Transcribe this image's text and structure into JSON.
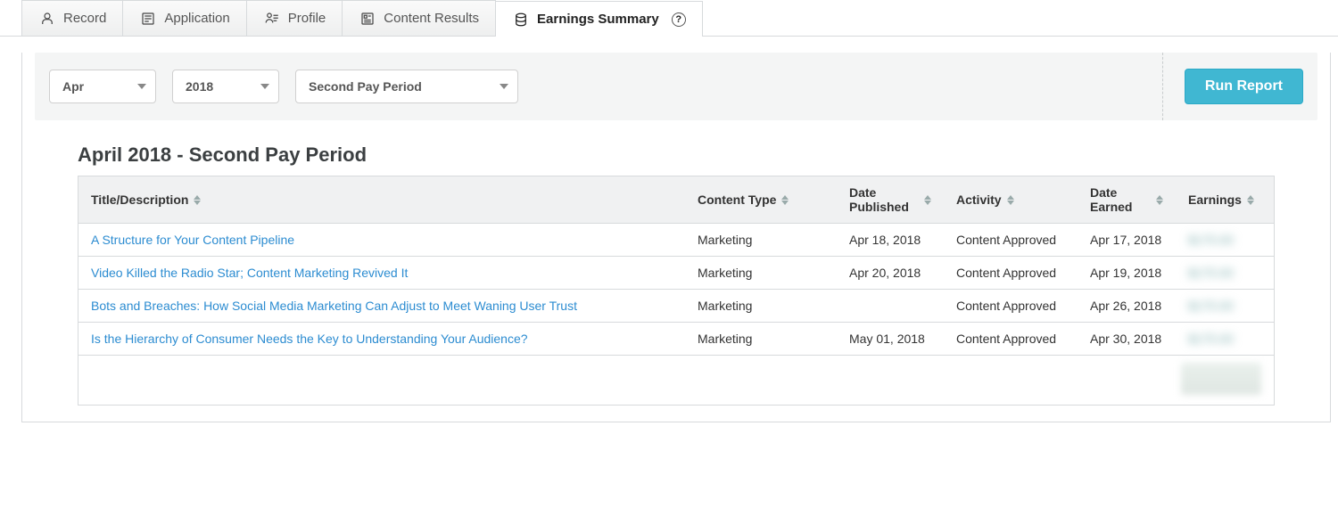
{
  "tabs": [
    {
      "label": "Record"
    },
    {
      "label": "Application"
    },
    {
      "label": "Profile"
    },
    {
      "label": "Content Results"
    },
    {
      "label": "Earnings Summary"
    }
  ],
  "filters": {
    "month": "Apr",
    "year": "2018",
    "period": "Second Pay Period"
  },
  "actions": {
    "run": "Run Report"
  },
  "report": {
    "title": "April 2018 - Second Pay Period",
    "columns": {
      "title": "Title/Description",
      "type": "Content Type",
      "published": "Date Published",
      "activity": "Activity",
      "earned": "Date Earned",
      "earnings": "Earnings"
    },
    "rows": [
      {
        "title": "A Structure for Your Content Pipeline",
        "type": "Marketing",
        "published": "Apr 18, 2018",
        "activity": "Content Approved",
        "earned": "Apr 17, 2018",
        "earn": "$175.00"
      },
      {
        "title": "Video Killed the Radio Star; Content Marketing Revived It",
        "type": "Marketing",
        "published": "Apr 20, 2018",
        "activity": "Content Approved",
        "earned": "Apr 19, 2018",
        "earn": "$175.00"
      },
      {
        "title": "Bots and Breaches: How Social Media Marketing Can Adjust to Meet Waning User Trust",
        "type": "Marketing",
        "published": "",
        "activity": "Content Approved",
        "earned": "Apr 26, 2018",
        "earn": "$175.00"
      },
      {
        "title": "Is the Hierarchy of Consumer Needs the Key to Understanding Your Audience?",
        "type": "Marketing",
        "published": "May 01, 2018",
        "activity": "Content Approved",
        "earned": "Apr 30, 2018",
        "earn": "$175.00"
      }
    ]
  }
}
